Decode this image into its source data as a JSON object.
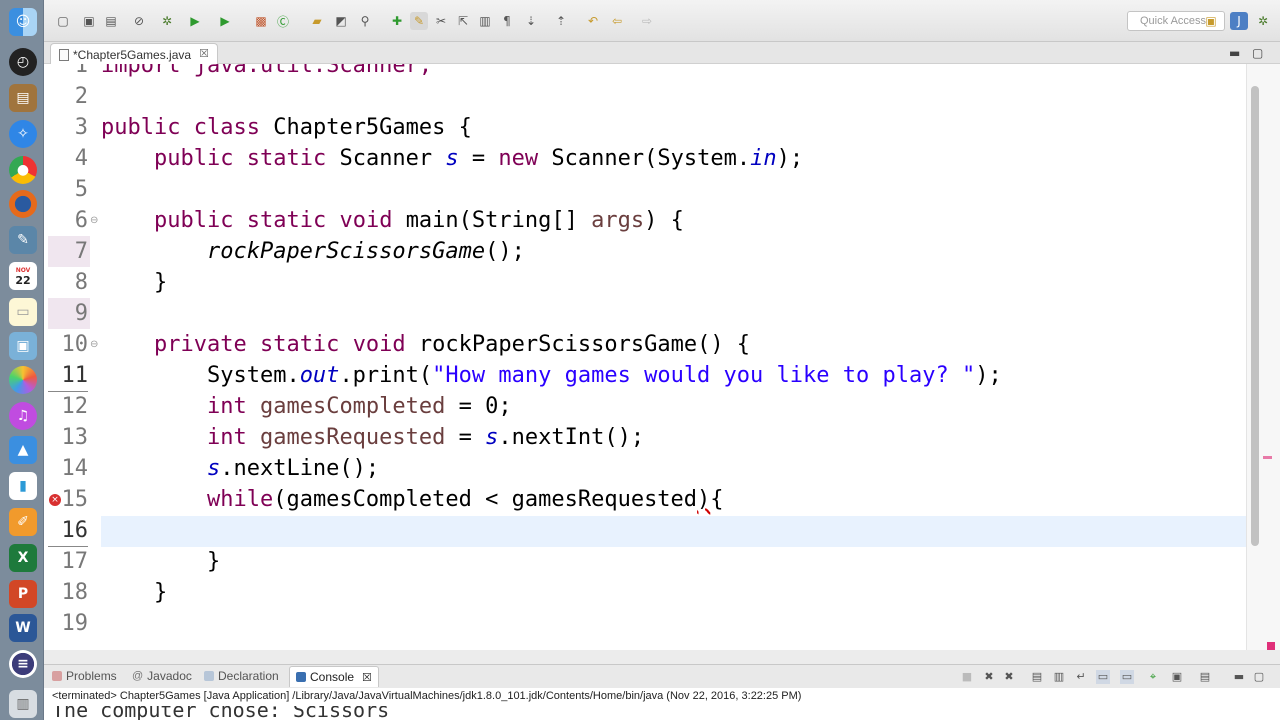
{
  "dock": {
    "icons": [
      "finder-icon",
      "dashboard-icon",
      "notes-icon",
      "safari-icon",
      "chrome-icon",
      "firefox-icon",
      "preview-icon",
      "calendar-icon",
      "notepad-icon",
      "photo-icon",
      "photos-icon",
      "itunes-icon",
      "keynote-icon",
      "numbers-icon",
      "pages-icon",
      "excel-icon",
      "powerpoint-icon",
      "word-icon",
      "eclipse-icon",
      "trash-icon"
    ],
    "calendar_day": "22",
    "calendar_month": "NOV"
  },
  "toolbar": {
    "quick_access_placeholder": "Quick Access"
  },
  "editor_tab": {
    "label": "*Chapter5Games.java",
    "close": "☒"
  },
  "code": {
    "lines": [
      {
        "n": "1",
        "text": "import java.util.Scanner;"
      },
      {
        "n": "2"
      },
      {
        "n": "3"
      },
      {
        "n": "4"
      },
      {
        "n": "5"
      },
      {
        "n": "6"
      },
      {
        "n": "7"
      },
      {
        "n": "8"
      },
      {
        "n": "9"
      },
      {
        "n": "10"
      },
      {
        "n": "11"
      },
      {
        "n": "12"
      },
      {
        "n": "13"
      },
      {
        "n": "14"
      },
      {
        "n": "15"
      },
      {
        "n": "16"
      },
      {
        "n": "17"
      },
      {
        "n": "18"
      },
      {
        "n": "19"
      }
    ],
    "tokens": {
      "public": "public",
      "class": "class",
      "class_name": "Chapter5Games",
      "static": "static",
      "scanner_type": "Scanner",
      "s": "s",
      "new": "new",
      "scanner_ctor": "Scanner(System.",
      "in": "in",
      "close_stmt": ");",
      "void": "void",
      "main": "main(String[] ",
      "args": "args",
      "main_end": ") {",
      "call_rps": "rockPaperScissorsGame",
      "call_end": "();",
      "brace_close": "}",
      "brace_open": " {",
      "private": "private",
      "rps_decl": "rockPaperScissorsGame() {",
      "system": "System.",
      "out": "out",
      "print": ".print(",
      "prompt_string": "\"How many games would you like to play? \"",
      "int": "int",
      "games_completed": "gamesCompleted",
      "assign_zero": " = 0;",
      "games_requested": "gamesRequested",
      "assign": " = ",
      "next_int": ".nextInt();",
      "next_line": ".nextLine();",
      "while": "while",
      "while_cond": "(gamesCompleted < gamesRequested",
      "while_close": ")",
      "while_brace": "{"
    }
  },
  "bottom_panel": {
    "tabs": [
      {
        "label": "Problems"
      },
      {
        "label": "Javadoc"
      },
      {
        "label": "Declaration"
      },
      {
        "label": "Console",
        "active": true
      }
    ],
    "console_status": "<terminated> Chapter5Games [Java Application] /Library/Java/JavaVirtualMachines/jdk1.8.0_101.jdk/Contents/Home/bin/java (Nov 22, 2016, 3:22:25 PM)",
    "console_ghost_text": "The computer chose: Scissors"
  },
  "colors": {
    "keyword": "#7f0055",
    "string": "#2a00ff",
    "field": "#0000c0",
    "current_line": "#e8f2fe",
    "error": "#d83030"
  }
}
